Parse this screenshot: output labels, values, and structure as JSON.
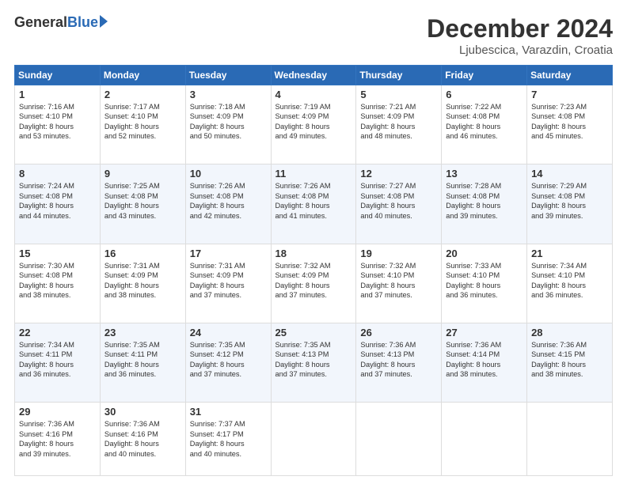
{
  "logo": {
    "general": "General",
    "blue": "Blue"
  },
  "title": "December 2024",
  "location": "Ljubescica, Varazdin, Croatia",
  "days_header": [
    "Sunday",
    "Monday",
    "Tuesday",
    "Wednesday",
    "Thursday",
    "Friday",
    "Saturday"
  ],
  "weeks": [
    [
      {
        "day": "1",
        "text": "Sunrise: 7:16 AM\nSunset: 4:10 PM\nDaylight: 8 hours\nand 53 minutes."
      },
      {
        "day": "2",
        "text": "Sunrise: 7:17 AM\nSunset: 4:10 PM\nDaylight: 8 hours\nand 52 minutes."
      },
      {
        "day": "3",
        "text": "Sunrise: 7:18 AM\nSunset: 4:09 PM\nDaylight: 8 hours\nand 50 minutes."
      },
      {
        "day": "4",
        "text": "Sunrise: 7:19 AM\nSunset: 4:09 PM\nDaylight: 8 hours\nand 49 minutes."
      },
      {
        "day": "5",
        "text": "Sunrise: 7:21 AM\nSunset: 4:09 PM\nDaylight: 8 hours\nand 48 minutes."
      },
      {
        "day": "6",
        "text": "Sunrise: 7:22 AM\nSunset: 4:08 PM\nDaylight: 8 hours\nand 46 minutes."
      },
      {
        "day": "7",
        "text": "Sunrise: 7:23 AM\nSunset: 4:08 PM\nDaylight: 8 hours\nand 45 minutes."
      }
    ],
    [
      {
        "day": "8",
        "text": "Sunrise: 7:24 AM\nSunset: 4:08 PM\nDaylight: 8 hours\nand 44 minutes."
      },
      {
        "day": "9",
        "text": "Sunrise: 7:25 AM\nSunset: 4:08 PM\nDaylight: 8 hours\nand 43 minutes."
      },
      {
        "day": "10",
        "text": "Sunrise: 7:26 AM\nSunset: 4:08 PM\nDaylight: 8 hours\nand 42 minutes."
      },
      {
        "day": "11",
        "text": "Sunrise: 7:26 AM\nSunset: 4:08 PM\nDaylight: 8 hours\nand 41 minutes."
      },
      {
        "day": "12",
        "text": "Sunrise: 7:27 AM\nSunset: 4:08 PM\nDaylight: 8 hours\nand 40 minutes."
      },
      {
        "day": "13",
        "text": "Sunrise: 7:28 AM\nSunset: 4:08 PM\nDaylight: 8 hours\nand 39 minutes."
      },
      {
        "day": "14",
        "text": "Sunrise: 7:29 AM\nSunset: 4:08 PM\nDaylight: 8 hours\nand 39 minutes."
      }
    ],
    [
      {
        "day": "15",
        "text": "Sunrise: 7:30 AM\nSunset: 4:08 PM\nDaylight: 8 hours\nand 38 minutes."
      },
      {
        "day": "16",
        "text": "Sunrise: 7:31 AM\nSunset: 4:09 PM\nDaylight: 8 hours\nand 38 minutes."
      },
      {
        "day": "17",
        "text": "Sunrise: 7:31 AM\nSunset: 4:09 PM\nDaylight: 8 hours\nand 37 minutes."
      },
      {
        "day": "18",
        "text": "Sunrise: 7:32 AM\nSunset: 4:09 PM\nDaylight: 8 hours\nand 37 minutes."
      },
      {
        "day": "19",
        "text": "Sunrise: 7:32 AM\nSunset: 4:10 PM\nDaylight: 8 hours\nand 37 minutes."
      },
      {
        "day": "20",
        "text": "Sunrise: 7:33 AM\nSunset: 4:10 PM\nDaylight: 8 hours\nand 36 minutes."
      },
      {
        "day": "21",
        "text": "Sunrise: 7:34 AM\nSunset: 4:10 PM\nDaylight: 8 hours\nand 36 minutes."
      }
    ],
    [
      {
        "day": "22",
        "text": "Sunrise: 7:34 AM\nSunset: 4:11 PM\nDaylight: 8 hours\nand 36 minutes."
      },
      {
        "day": "23",
        "text": "Sunrise: 7:35 AM\nSunset: 4:11 PM\nDaylight: 8 hours\nand 36 minutes."
      },
      {
        "day": "24",
        "text": "Sunrise: 7:35 AM\nSunset: 4:12 PM\nDaylight: 8 hours\nand 37 minutes."
      },
      {
        "day": "25",
        "text": "Sunrise: 7:35 AM\nSunset: 4:13 PM\nDaylight: 8 hours\nand 37 minutes."
      },
      {
        "day": "26",
        "text": "Sunrise: 7:36 AM\nSunset: 4:13 PM\nDaylight: 8 hours\nand 37 minutes."
      },
      {
        "day": "27",
        "text": "Sunrise: 7:36 AM\nSunset: 4:14 PM\nDaylight: 8 hours\nand 38 minutes."
      },
      {
        "day": "28",
        "text": "Sunrise: 7:36 AM\nSunset: 4:15 PM\nDaylight: 8 hours\nand 38 minutes."
      }
    ],
    [
      {
        "day": "29",
        "text": "Sunrise: 7:36 AM\nSunset: 4:16 PM\nDaylight: 8 hours\nand 39 minutes."
      },
      {
        "day": "30",
        "text": "Sunrise: 7:36 AM\nSunset: 4:16 PM\nDaylight: 8 hours\nand 40 minutes."
      },
      {
        "day": "31",
        "text": "Sunrise: 7:37 AM\nSunset: 4:17 PM\nDaylight: 8 hours\nand 40 minutes."
      },
      {
        "day": "",
        "text": ""
      },
      {
        "day": "",
        "text": ""
      },
      {
        "day": "",
        "text": ""
      },
      {
        "day": "",
        "text": ""
      }
    ]
  ]
}
